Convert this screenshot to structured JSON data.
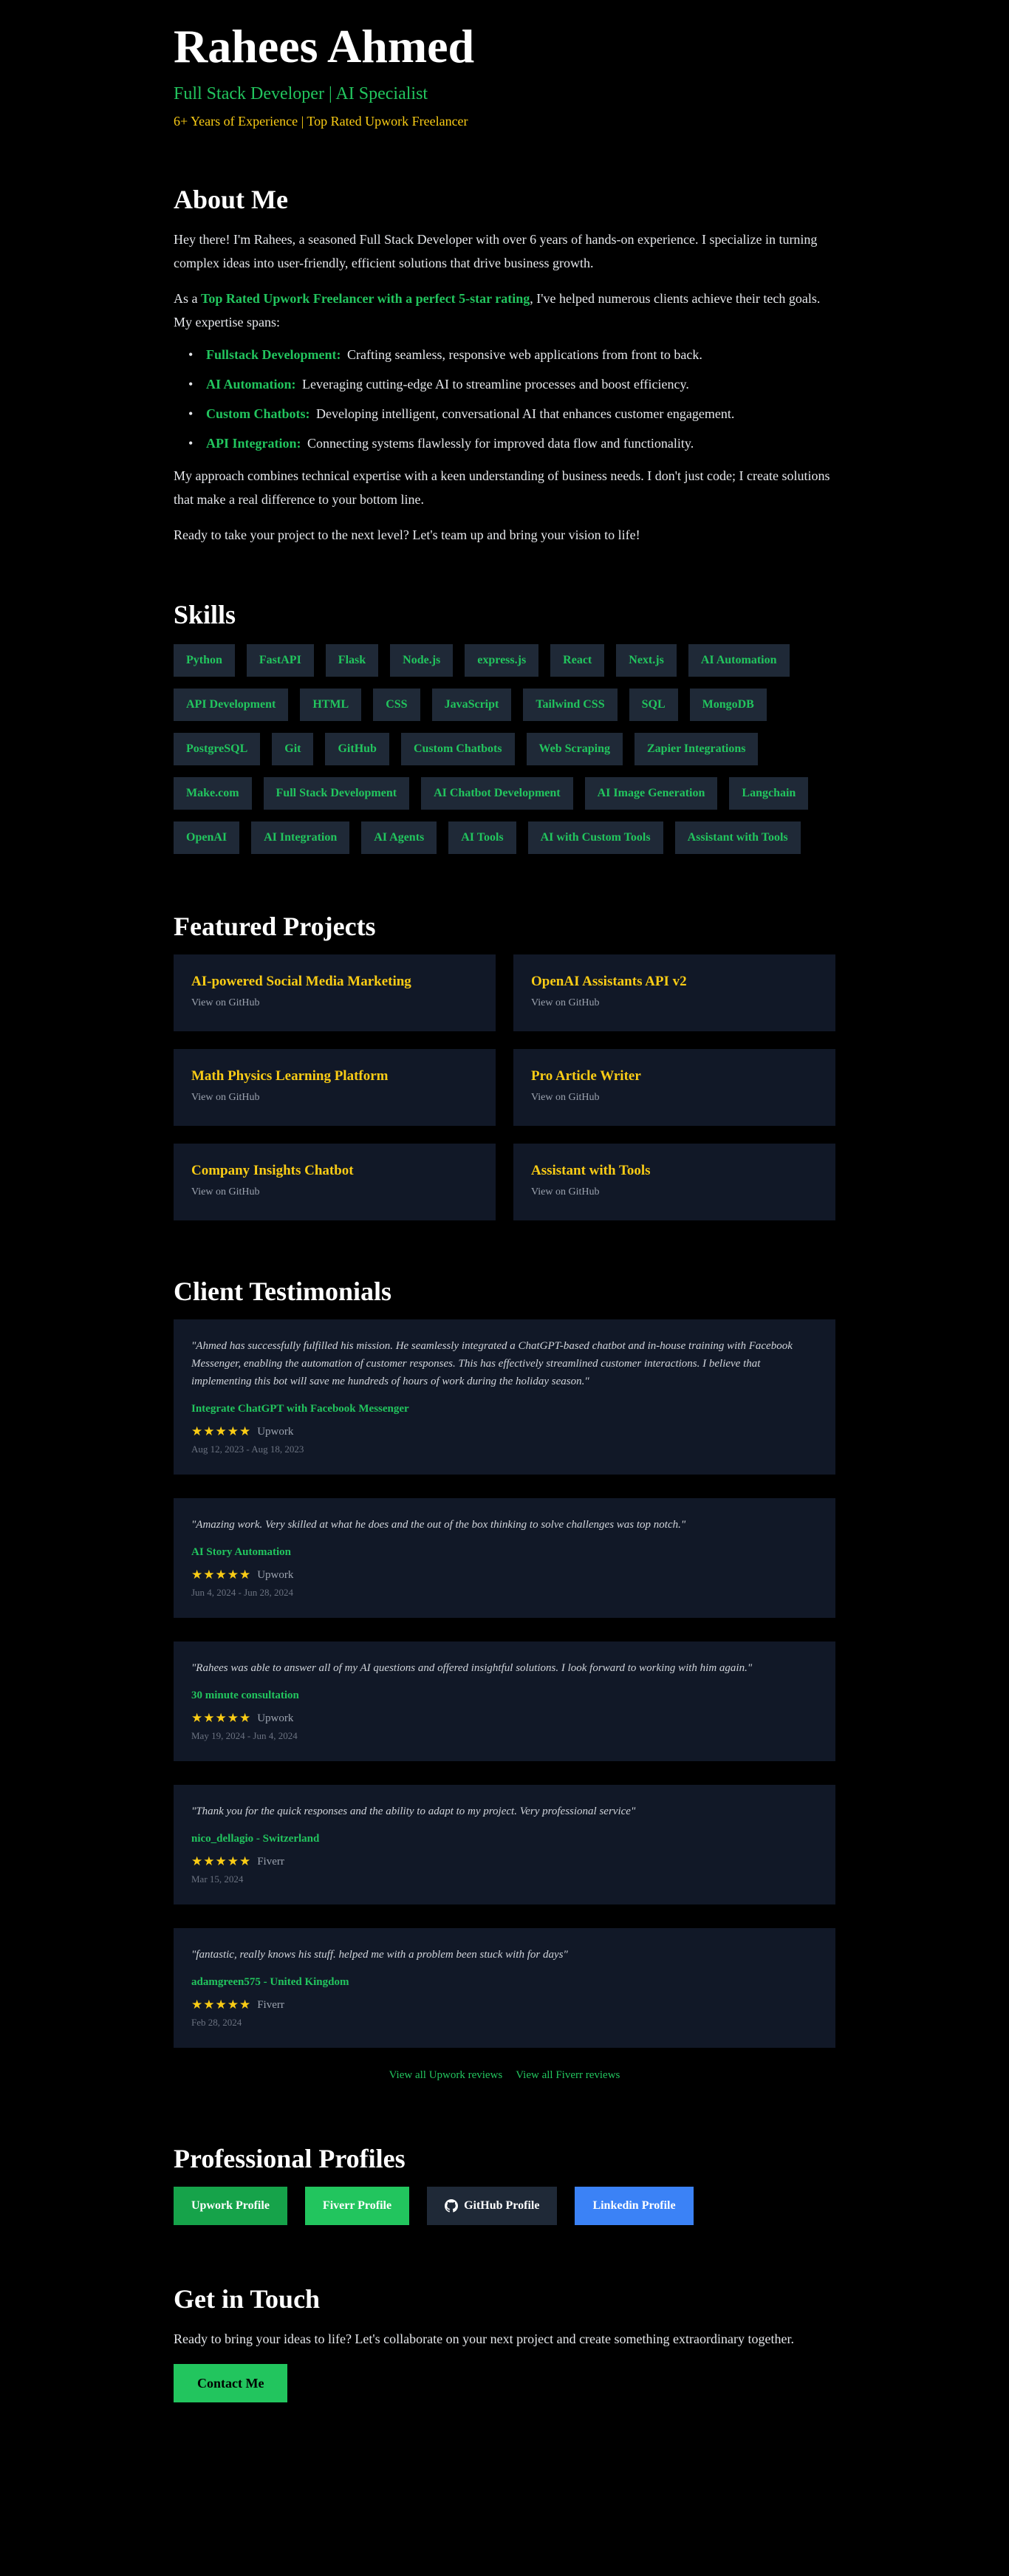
{
  "header": {
    "name": "Rahees Ahmed",
    "subtitle": "Full Stack Developer | AI Specialist",
    "tagline": "6+ Years of Experience | Top Rated Upwork Freelancer"
  },
  "about": {
    "heading": "About Me",
    "p1": "Hey there! I'm Rahees, a seasoned Full Stack Developer with over 6 years of hands-on experience. I specialize in turning complex ideas into user-friendly, efficient solutions that drive business growth.",
    "p2_before": "As a ",
    "p2_highlight": "Top Rated Upwork Freelancer with a perfect 5-star rating",
    "p2_after": ", I've helped numerous clients achieve their tech goals. My expertise spans:",
    "items": [
      {
        "label": "Fullstack Development:",
        "text": "Crafting seamless, responsive web applications from front to back."
      },
      {
        "label": "AI Automation:",
        "text": "Leveraging cutting-edge AI to streamline processes and boost efficiency."
      },
      {
        "label": "Custom Chatbots:",
        "text": "Developing intelligent, conversational AI that enhances customer engagement."
      },
      {
        "label": "API Integration:",
        "text": "Connecting systems flawlessly for improved data flow and functionality."
      }
    ],
    "p3": "My approach combines technical expertise with a keen understanding of business needs. I don't just code; I create solutions that make a real difference to your bottom line.",
    "p4": "Ready to take your project to the next level? Let's team up and bring your vision to life!"
  },
  "skills": {
    "heading": "Skills",
    "items": [
      "Python",
      "FastAPI",
      "Flask",
      "Node.js",
      "express.js",
      "React",
      "Next.js",
      "AI Automation",
      "API Development",
      "HTML",
      "CSS",
      "JavaScript",
      "Tailwind CSS",
      "SQL",
      "MongoDB",
      "PostgreSQL",
      "Git",
      "GitHub",
      "Custom Chatbots",
      "Web Scraping",
      "Zapier Integrations",
      "Make.com",
      "Full Stack Development",
      "AI Chatbot Development",
      "AI Image Generation",
      "Langchain",
      "OpenAI",
      "AI Integration",
      "AI Agents",
      "AI Tools",
      "AI with Custom Tools",
      "Assistant with Tools"
    ]
  },
  "projects": {
    "heading": "Featured Projects",
    "link_label": "View on GitHub",
    "items": [
      "AI-powered Social Media Marketing",
      "OpenAI Assistants API v2",
      "Math Physics Learning Platform",
      "Pro Article Writer",
      "Company Insights Chatbot",
      "Assistant with Tools"
    ]
  },
  "testimonials": {
    "heading": "Client Testimonials",
    "stars": "★★★★★",
    "items": [
      {
        "quote": "\"Ahmed has successfully fulfilled his mission. He seamlessly integrated a ChatGPT-based chatbot and in-house training with Facebook Messenger, enabling the automation of customer responses. This has effectively streamlined customer interactions. I believe that implementing this bot will save me hundreds of hours of work during the holiday season.\"",
        "title": "Integrate ChatGPT with Facebook Messenger",
        "platform": "Upwork",
        "date": "Aug 12, 2023 - Aug 18, 2023"
      },
      {
        "quote": "\"Amazing work. Very skilled at what he does and the out of the box thinking to solve challenges was top notch.\"",
        "title": "AI Story Automation",
        "platform": "Upwork",
        "date": "Jun 4, 2024 - Jun 28, 2024"
      },
      {
        "quote": "\"Rahees was able to answer all of my AI questions and offered insightful solutions. I look forward to working with him again.\"",
        "title": "30 minute consultation",
        "platform": "Upwork",
        "date": "May 19, 2024 - Jun 4, 2024"
      },
      {
        "quote": "\"Thank you for the quick responses and the ability to adapt to my project. Very professional service\"",
        "title": "nico_dellagio - Switzerland",
        "platform": "Fiverr",
        "date": "Mar 15, 2024"
      },
      {
        "quote": "\"fantastic, really knows his stuff. helped me with a problem been stuck with for days\"",
        "title": "adamgreen575 - United Kingdom",
        "platform": "Fiverr",
        "date": "Feb 28, 2024"
      }
    ],
    "link_upwork": "View all Upwork reviews",
    "link_fiverr": "View all Fiverr reviews"
  },
  "profiles": {
    "heading": "Professional Profiles",
    "items": [
      {
        "label": "Upwork Profile",
        "color": "#16a34a",
        "icon": ""
      },
      {
        "label": "Fiverr Profile",
        "color": "#22c55e",
        "icon": ""
      },
      {
        "label": "GitHub Profile",
        "color": "#1f2937",
        "icon": "github-icon"
      },
      {
        "label": "Linkedin Profile",
        "color": "#3b82f6",
        "icon": ""
      }
    ]
  },
  "contact": {
    "heading": "Get in Touch",
    "text": "Ready to bring your ideas to life? Let's collaborate on your next project and create something extraordinary together.",
    "button": "Contact Me"
  }
}
